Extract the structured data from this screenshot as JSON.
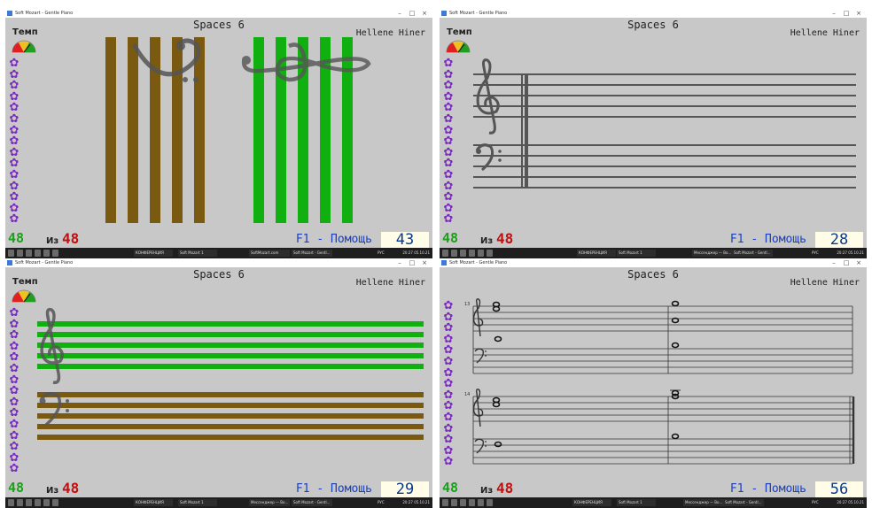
{
  "window_title": "Soft Mozart - Gentle Piano",
  "song_title": "Spaces 6",
  "composer": "Hellene Hiner",
  "tempo_label": "Темп",
  "of_label": "Из",
  "total": "48",
  "help_label": "F1 - Помощь",
  "flower_icon": "flower-icon",
  "colors": {
    "brown": "#7a5a10",
    "green": "#10b010",
    "staff": "#555555",
    "bg": "#c8c8c8"
  },
  "taskbar": {
    "apps": [
      "КОНФЕРЕНЦИЯ",
      "Soft Mozart 1",
      "SoftMozart.com",
      "Soft Mozart - Gentl..."
    ],
    "apps_2": [
      "КОНФЕРЕНЦИЯ",
      "Soft Mozart 1",
      "Мессенджер — Во...",
      "Soft Mozart - Gentl..."
    ],
    "lang": "РУС",
    "time": "20:27",
    "date": "05.10.21"
  },
  "screens": [
    {
      "counter": "43",
      "view": "Clef stripes: bass clef over brown vertical bars, treble clef over green vertical bars"
    },
    {
      "counter": "28",
      "view": "Grand staff: treble and bass staves with barline"
    },
    {
      "counter": "29",
      "view": "Horizontal colored staves: green treble lines, brown bass lines"
    },
    {
      "counter": "56",
      "view": "Sheet music: two systems of grand staff with whole notes",
      "measure_1": "13",
      "measure_2": "14"
    }
  ]
}
